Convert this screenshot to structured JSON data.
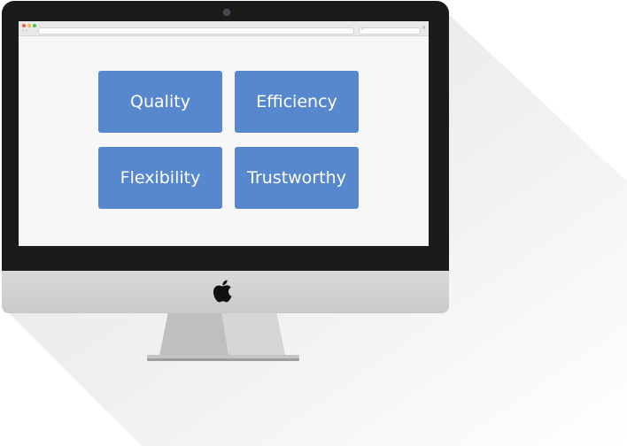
{
  "monitor": {
    "brand_icon": "apple-logo-icon"
  },
  "browser": {
    "window_controls": [
      "close",
      "minimize",
      "zoom"
    ],
    "nav_icons": [
      "back-arrow-icon",
      "forward-arrow-icon"
    ],
    "address_bar_value": "",
    "search_icon": "search-icon",
    "close_icon": "close-icon"
  },
  "tiles": [
    {
      "label": "Quality"
    },
    {
      "label": "Efficiency"
    },
    {
      "label": "Flexibility"
    },
    {
      "label": "Trustworthy"
    }
  ],
  "colors": {
    "tile": "#5787cc",
    "screen": "#f7f7f7",
    "bezel": "#1b1b1b",
    "chin": "#d3d3d3"
  }
}
